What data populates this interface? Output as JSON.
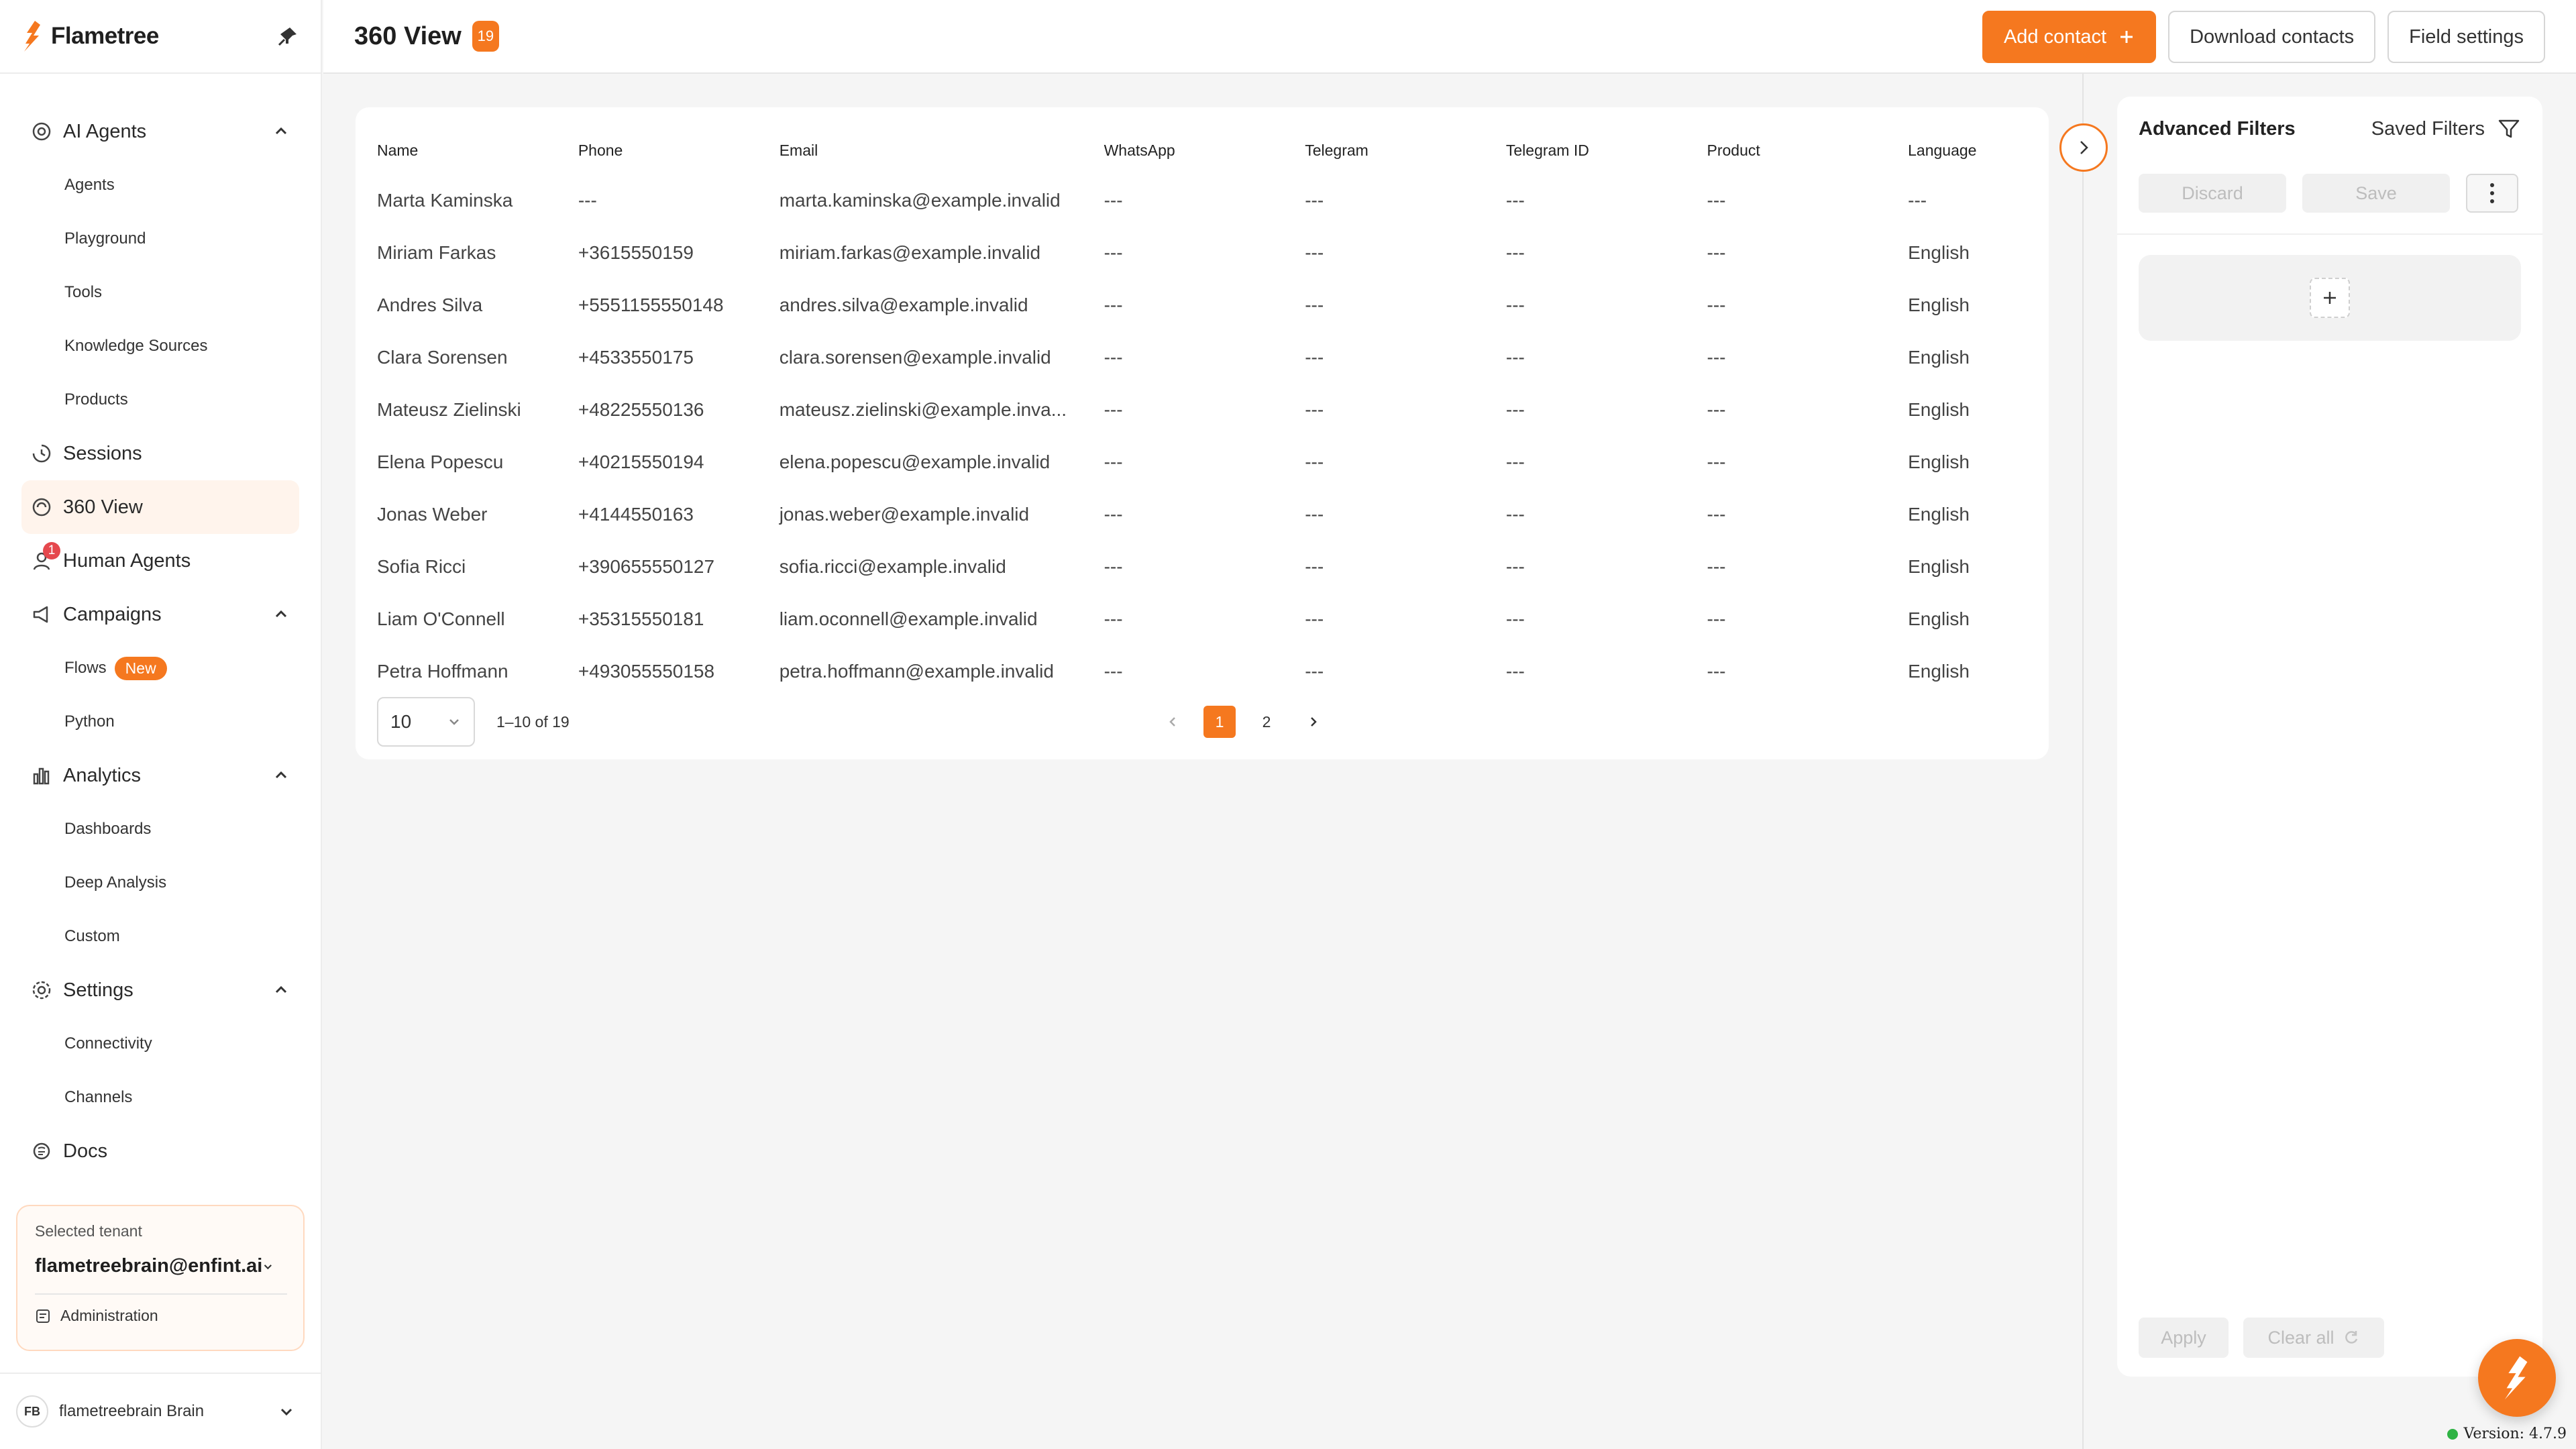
{
  "brand": {
    "name": "Flametree",
    "accent": "#f5781f"
  },
  "sidebar": {
    "nav": [
      {
        "label": "AI Agents",
        "icon": "ai-agents-icon",
        "expanded": true,
        "children": [
          "Agents",
          "Playground",
          "Tools",
          "Knowledge Sources",
          "Products"
        ]
      },
      {
        "label": "Sessions",
        "icon": "sessions-icon"
      },
      {
        "label": "360 View",
        "icon": "view-360-icon",
        "active": true
      },
      {
        "label": "Human Agents",
        "icon": "human-agents-icon",
        "badge": "1"
      },
      {
        "label": "Campaigns",
        "icon": "megaphone-icon",
        "expanded": true,
        "children": [
          "Flows",
          "Python"
        ],
        "flows_badge": "New"
      },
      {
        "label": "Analytics",
        "icon": "bar-chart-icon",
        "expanded": true,
        "children": [
          "Dashboards",
          "Deep Analysis",
          "Custom"
        ]
      },
      {
        "label": "Settings",
        "icon": "gear-icon",
        "expanded": true,
        "children": [
          "Connectivity",
          "Channels"
        ]
      },
      {
        "label": "Docs",
        "icon": "docs-icon"
      }
    ],
    "tenant": {
      "label": "Selected tenant",
      "value": "flametreebrain@enfint.ai",
      "admin": "Administration"
    },
    "footer": {
      "initials": "FB",
      "name": "flametreebrain Brain"
    }
  },
  "header": {
    "title": "360 View",
    "count": "19",
    "add_contact": "Add contact",
    "download": "Download contacts",
    "field_settings": "Field settings"
  },
  "table": {
    "columns": [
      "Name",
      "Phone",
      "Email",
      "WhatsApp",
      "Telegram",
      "Telegram ID",
      "Product",
      "Language"
    ],
    "rows": [
      [
        "Marta Kaminska",
        "---",
        "marta.kaminska@example.invalid",
        "---",
        "---",
        "---",
        "---",
        "---"
      ],
      [
        "Miriam Farkas",
        "+3615550159",
        "miriam.farkas@example.invalid",
        "---",
        "---",
        "---",
        "---",
        "English"
      ],
      [
        "Andres Silva",
        "+5551155550148",
        "andres.silva@example.invalid",
        "---",
        "---",
        "---",
        "---",
        "English"
      ],
      [
        "Clara Sorensen",
        "+4533550175",
        "clara.sorensen@example.invalid",
        "---",
        "---",
        "---",
        "---",
        "English"
      ],
      [
        "Mateusz Zielinski",
        "+48225550136",
        "mateusz.zielinski@example.inva...",
        "---",
        "---",
        "---",
        "---",
        "English"
      ],
      [
        "Elena Popescu",
        "+40215550194",
        "elena.popescu@example.invalid",
        "---",
        "---",
        "---",
        "---",
        "English"
      ],
      [
        "Jonas Weber",
        "+4144550163",
        "jonas.weber@example.invalid",
        "---",
        "---",
        "---",
        "---",
        "English"
      ],
      [
        "Sofia Ricci",
        "+390655550127",
        "sofia.ricci@example.invalid",
        "---",
        "---",
        "---",
        "---",
        "English"
      ],
      [
        "Liam O'Connell",
        "+35315550181",
        "liam.oconnell@example.invalid",
        "---",
        "---",
        "---",
        "---",
        "English"
      ],
      [
        "Petra Hoffmann",
        "+493055550158",
        "petra.hoffmann@example.invalid",
        "---",
        "---",
        "---",
        "---",
        "English"
      ]
    ],
    "page_size": "10",
    "range": "1–10 of 19",
    "pages": [
      "1",
      "2"
    ],
    "current_page": "1"
  },
  "filters": {
    "title": "Advanced Filters",
    "saved": "Saved Filters",
    "discard": "Discard",
    "save": "Save",
    "apply": "Apply",
    "clear_all": "Clear all"
  },
  "version": "Version: 4.7.9"
}
